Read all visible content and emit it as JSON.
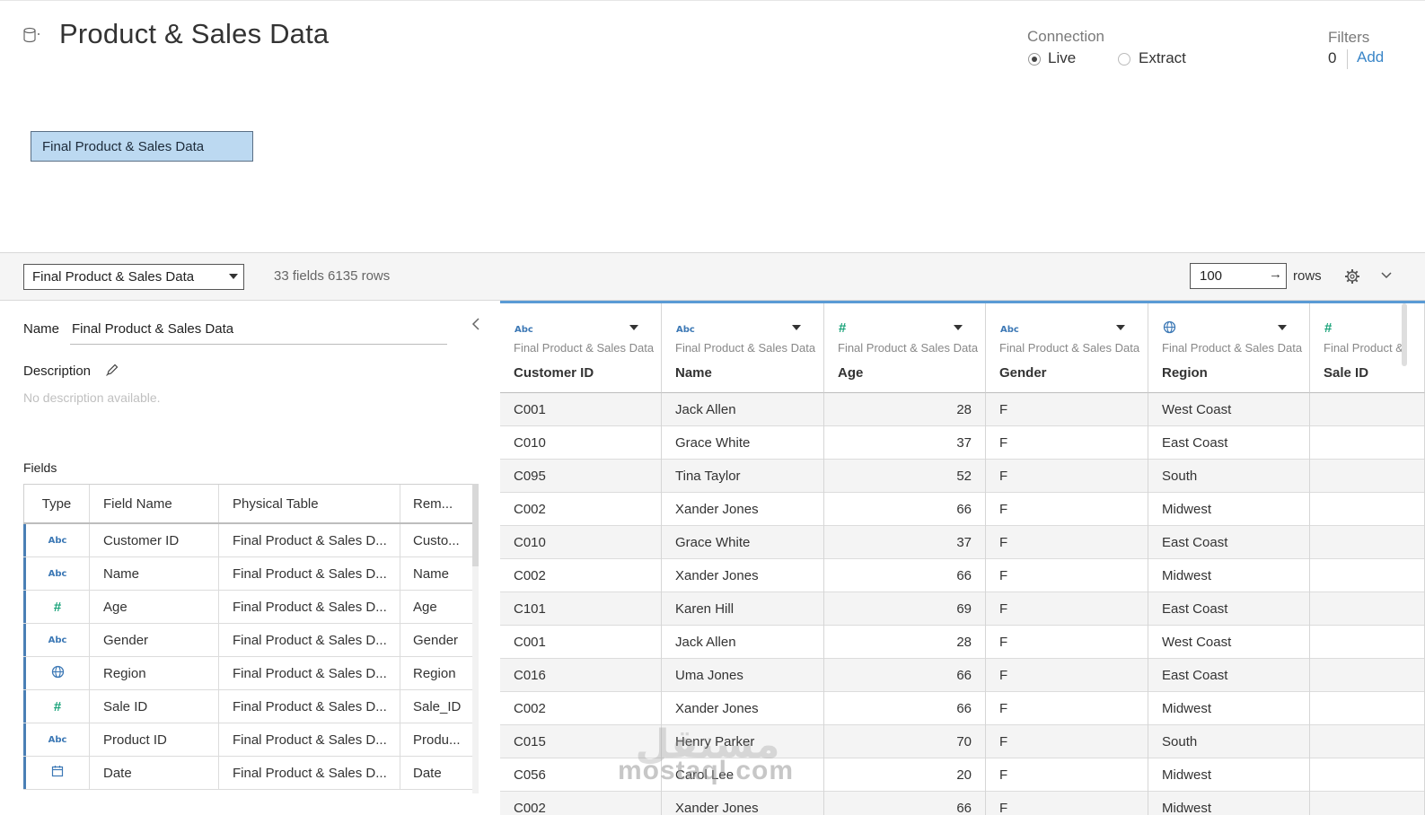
{
  "header": {
    "title": "Product & Sales Data",
    "connection": {
      "label": "Connection",
      "live": "Live",
      "extract": "Extract",
      "selected": "Live"
    },
    "filters": {
      "label": "Filters",
      "count": "0",
      "add": "Add"
    }
  },
  "canvas": {
    "table_node": "Final Product & Sales Data"
  },
  "toolbar": {
    "datasource": "Final Product & Sales Data",
    "summary": "33 fields 6135 rows",
    "rows_value": "100",
    "rows_label": "rows"
  },
  "metadata": {
    "name_label": "Name",
    "name_value": "Final Product & Sales Data",
    "description_label": "Description",
    "description_value": "No description available.",
    "fields_label": "Fields",
    "columns": [
      "Type",
      "Field Name",
      "Physical Table",
      "Rem..."
    ],
    "fields": [
      {
        "type": "Abc",
        "type_icon": "string-type",
        "name": "Customer ID",
        "table": "Final Product & Sales D...",
        "remote": "Custo..."
      },
      {
        "type": "Abc",
        "type_icon": "string-type",
        "name": "Name",
        "table": "Final Product & Sales D...",
        "remote": "Name"
      },
      {
        "type": "#",
        "type_icon": "number-type",
        "name": "Age",
        "table": "Final Product & Sales D...",
        "remote": "Age"
      },
      {
        "type": "Abc",
        "type_icon": "string-type",
        "name": "Gender",
        "table": "Final Product & Sales D...",
        "remote": "Gender"
      },
      {
        "type": "",
        "type_icon": "globe-icon",
        "name": "Region",
        "table": "Final Product & Sales D...",
        "remote": "Region"
      },
      {
        "type": "#",
        "type_icon": "number-type",
        "name": "Sale ID",
        "table": "Final Product & Sales D...",
        "remote": "Sale_ID"
      },
      {
        "type": "Abc",
        "type_icon": "string-type",
        "name": "Product ID",
        "table": "Final Product & Sales D...",
        "remote": "Produ..."
      },
      {
        "type": "",
        "type_icon": "calendar-icon",
        "name": "Date",
        "table": "Final Product & Sales D...",
        "remote": "Date"
      }
    ]
  },
  "grid": {
    "columns": [
      {
        "type": "Abc",
        "type_icon": "string-type",
        "table": "Final Product & Sales Data",
        "name": "Customer ID"
      },
      {
        "type": "Abc",
        "type_icon": "string-type",
        "table": "Final Product & Sales Data",
        "name": "Name"
      },
      {
        "type": "#",
        "type_icon": "number-type",
        "table": "Final Product & Sales Data",
        "name": "Age"
      },
      {
        "type": "Abc",
        "type_icon": "string-type",
        "table": "Final Product & Sales Data",
        "name": "Gender"
      },
      {
        "type": "",
        "type_icon": "globe-icon",
        "table": "Final Product & Sales Data",
        "name": "Region"
      },
      {
        "type": "#",
        "type_icon": "number-type",
        "table": "Final Product &",
        "name": "Sale ID"
      }
    ],
    "rows": [
      [
        "C001",
        "Jack Allen",
        "28",
        "F",
        "West Coast",
        ""
      ],
      [
        "C010",
        "Grace White",
        "37",
        "F",
        "East Coast",
        ""
      ],
      [
        "C095",
        "Tina Taylor",
        "52",
        "F",
        "South",
        ""
      ],
      [
        "C002",
        "Xander Jones",
        "66",
        "F",
        "Midwest",
        ""
      ],
      [
        "C010",
        "Grace White",
        "37",
        "F",
        "East Coast",
        ""
      ],
      [
        "C002",
        "Xander Jones",
        "66",
        "F",
        "Midwest",
        ""
      ],
      [
        "C101",
        "Karen Hill",
        "69",
        "F",
        "East Coast",
        ""
      ],
      [
        "C001",
        "Jack Allen",
        "28",
        "F",
        "West Coast",
        ""
      ],
      [
        "C016",
        "Uma Jones",
        "66",
        "F",
        "East Coast",
        ""
      ],
      [
        "C002",
        "Xander Jones",
        "66",
        "F",
        "Midwest",
        ""
      ],
      [
        "C015",
        "Henry Parker",
        "70",
        "F",
        "South",
        ""
      ],
      [
        "C056",
        "Carol Lee",
        "20",
        "F",
        "Midwest",
        ""
      ],
      [
        "C002",
        "Xander Jones",
        "66",
        "F",
        "Midwest",
        ""
      ]
    ]
  },
  "watermark": {
    "text": "mostaql.com",
    "arabic": "مستقل"
  },
  "colors": {
    "accent": "#5a9bd5",
    "node_fill": "#bcd9f1",
    "string_type": "#3c78b5",
    "number_type": "#1aa37a",
    "link": "#3a86c8"
  }
}
